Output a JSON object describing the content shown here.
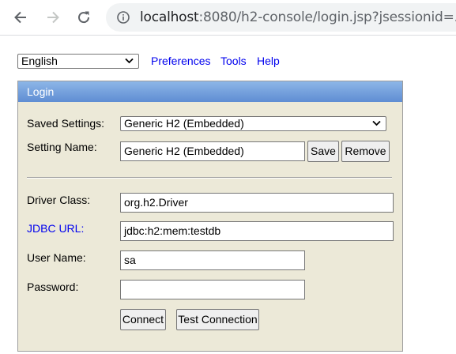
{
  "browser": {
    "url_host": "localhost",
    "url_rest": ":8080/h2-console/login.jsp?jsessionid=..."
  },
  "toolbar": {
    "language": "English",
    "preferences": "Preferences",
    "tools": "Tools",
    "help": "Help"
  },
  "login": {
    "header": "Login",
    "saved_settings_label": "Saved Settings:",
    "saved_settings_value": "Generic H2 (Embedded)",
    "setting_name_label": "Setting Name:",
    "setting_name_value": "Generic H2 (Embedded)",
    "save": "Save",
    "remove": "Remove",
    "driver_class_label": "Driver Class:",
    "driver_class_value": "org.h2.Driver",
    "jdbc_url_label": "JDBC URL:",
    "jdbc_url_value": "jdbc:h2:mem:testdb",
    "user_name_label": "User Name:",
    "user_name_value": "sa",
    "password_label": "Password:",
    "password_value": "",
    "connect": "Connect",
    "test_connection": "Test Connection"
  },
  "colors": {
    "panel_bg": "#ece9d8",
    "header_gradient_top": "#8db6e7",
    "header_gradient_bottom": "#5f8dd3",
    "link": "#0000ee"
  },
  "icons": {
    "back": "arrow-left-icon",
    "forward": "arrow-right-icon",
    "reload": "reload-icon",
    "site_info": "info-icon",
    "dropdown": "chevron-down-icon"
  }
}
